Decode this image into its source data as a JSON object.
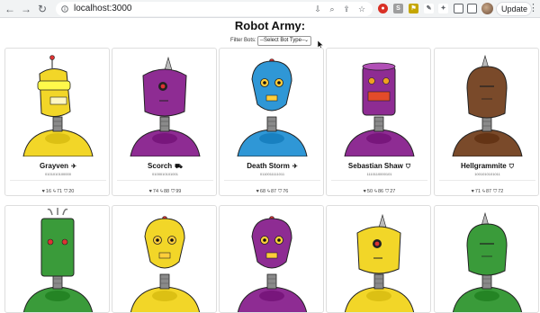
{
  "browser": {
    "url": "localhost:3000",
    "update_label": "Update",
    "kebab": "⋮",
    "ext_colors": [
      "#d93025",
      "#f4b400",
      "#c5a600",
      "#8d6e63",
      "#7b7b7b",
      "#5f6368"
    ]
  },
  "app": {
    "title": "Robot Army:",
    "filter_label": "Filter Bots:",
    "filter_value": "--Select Bot Type--"
  },
  "bots": [
    {
      "name": "Grayven",
      "type_icon": "plane-icon",
      "type_glyph": "✈",
      "binary": "0101010100000",
      "health": "16",
      "damage": "71",
      "armor": "20",
      "body": "#f2d628",
      "kind": "yellow-visor",
      "glyph_head": "visor"
    },
    {
      "name": "Scorch",
      "type_icon": "truck-icon",
      "type_glyph": "⛟",
      "binary": "0100010101001",
      "health": "74",
      "damage": "88",
      "armor": "99",
      "body": "#8e2c93",
      "kind": "purple-cyclops",
      "glyph_head": "round"
    },
    {
      "name": "Death Storm",
      "type_icon": "plane-icon",
      "type_glyph": "✈",
      "binary": "0110011111011",
      "health": "68",
      "damage": "87",
      "armor": "76",
      "body": "#2f97d6",
      "kind": "blue-bulb",
      "glyph_head": "bulb"
    },
    {
      "name": "Sebastian Shaw",
      "type_icon": "shield-icon",
      "type_glyph": "⛉",
      "binary": "1110110000101",
      "health": "50",
      "damage": "86",
      "armor": "27",
      "body": "#8e2c93",
      "kind": "purple-can",
      "glyph_head": "can"
    },
    {
      "name": "Hellgrammite",
      "type_icon": "shield-icon",
      "type_glyph": "⛉",
      "binary": "1001010101011",
      "health": "71",
      "damage": "87",
      "armor": "72",
      "body": "#7a4a2a",
      "kind": "brown-dome",
      "glyph_head": "dome"
    },
    {
      "name": "",
      "body": "#3a9b3a",
      "kind": "green-box",
      "glyph_head": "box"
    },
    {
      "name": "",
      "body": "#f2d628",
      "kind": "yellow-bulb",
      "glyph_head": "bulb"
    },
    {
      "name": "",
      "body": "#8e2c93",
      "kind": "purple-bulb",
      "glyph_head": "bulb"
    },
    {
      "name": "",
      "body": "#f2d628",
      "kind": "yellow-cyclops",
      "glyph_head": "round"
    },
    {
      "name": "",
      "body": "#3a9b3a",
      "kind": "green-dome",
      "glyph_head": "dome"
    }
  ]
}
